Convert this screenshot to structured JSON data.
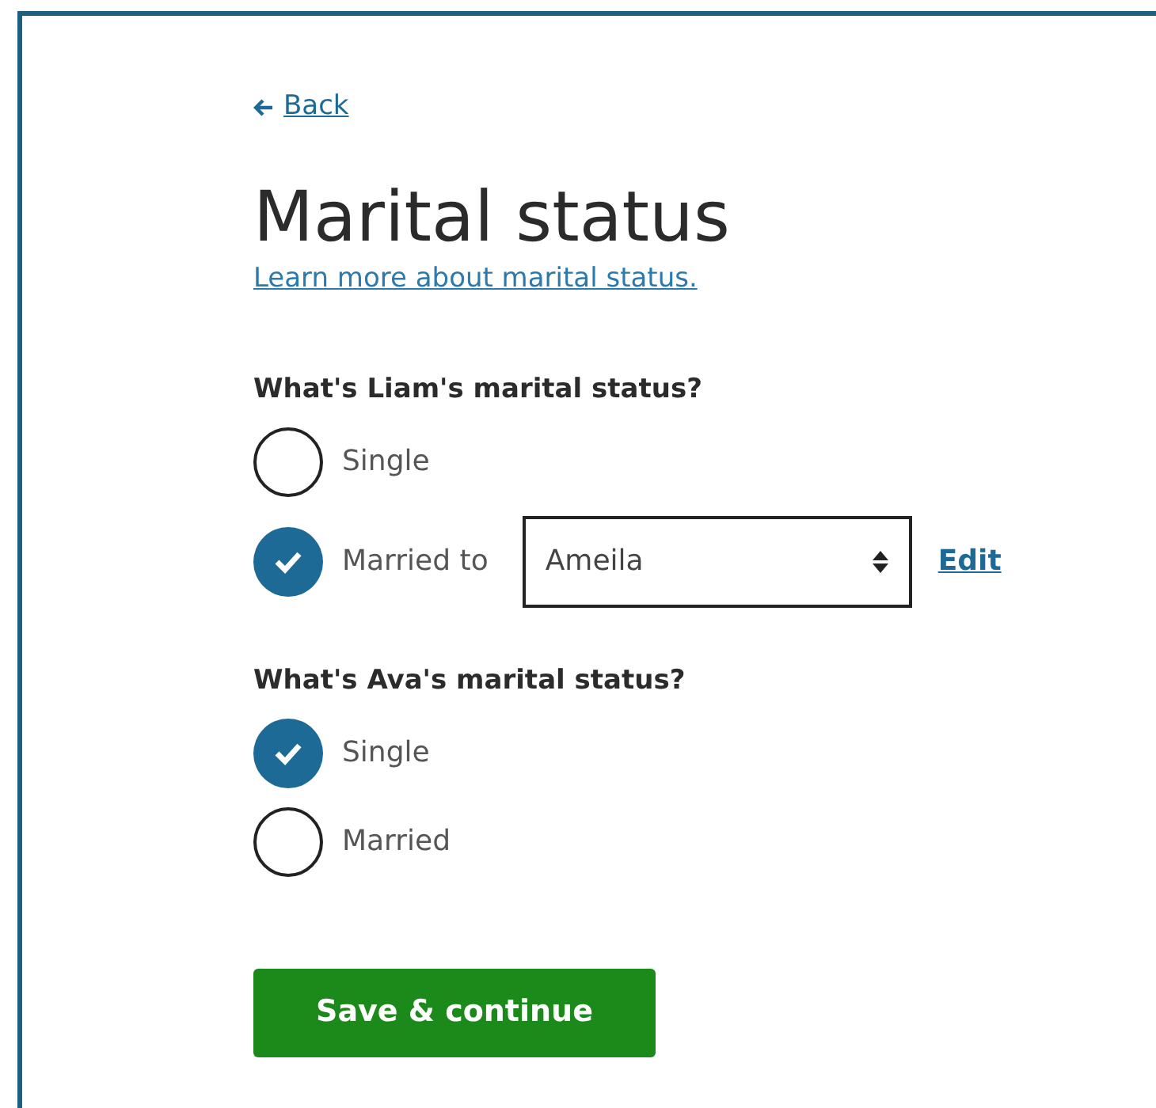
{
  "back_link": {
    "label": "Back"
  },
  "title": "Marital status",
  "help_link": "Learn more about marital status.",
  "questions": [
    {
      "label": "What's Liam's marital status?",
      "options": [
        {
          "kind": "plain",
          "label": "Single",
          "selected": false
        },
        {
          "kind": "with_select",
          "label": "Married to",
          "selected": true,
          "select": {
            "value": "Ameila"
          },
          "edit_link": "Edit"
        }
      ]
    },
    {
      "label": "What's Ava's marital status?",
      "options": [
        {
          "kind": "plain",
          "label": "Single",
          "selected": true
        },
        {
          "kind": "plain",
          "label": "Married",
          "selected": false
        }
      ]
    }
  ],
  "submit_button": "Save & continue"
}
